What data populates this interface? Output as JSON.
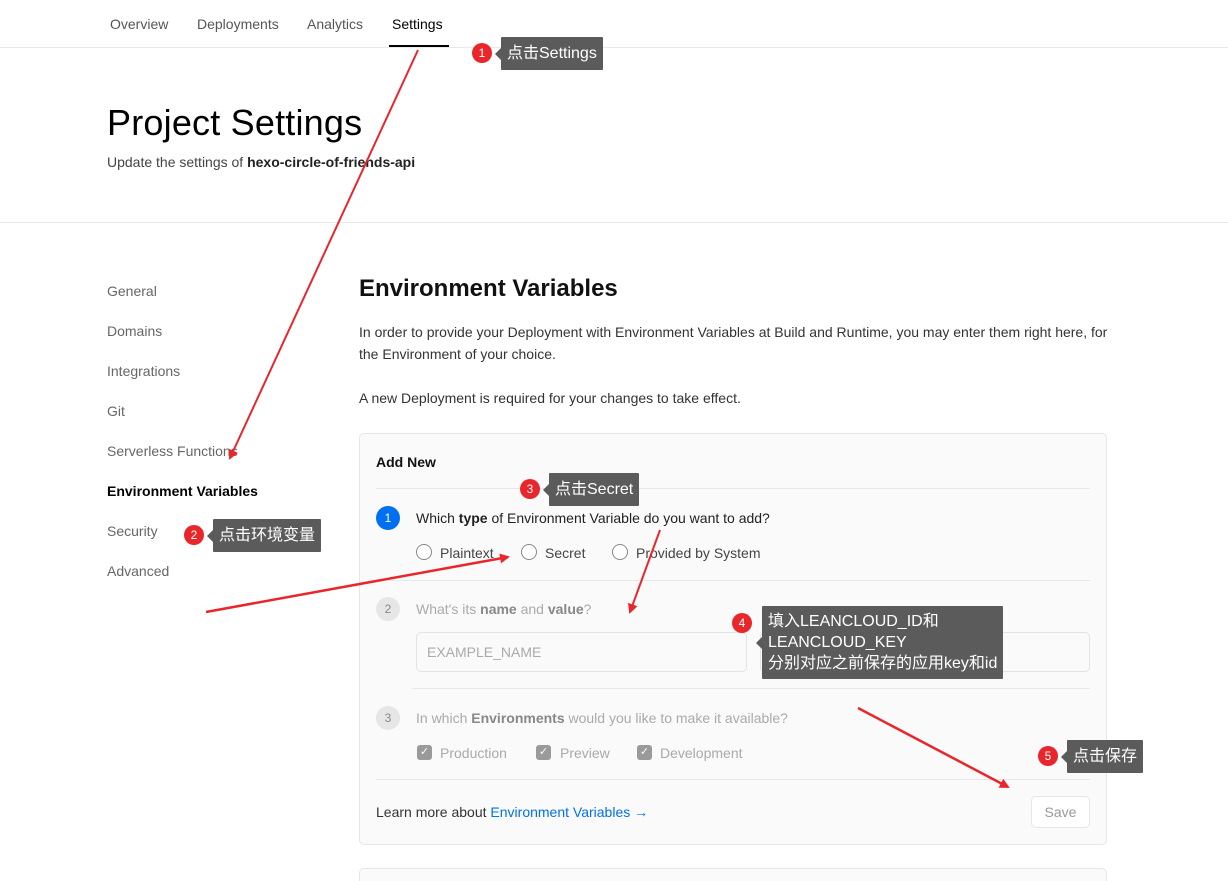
{
  "tabs": [
    "Overview",
    "Deployments",
    "Analytics",
    "Settings"
  ],
  "header": {
    "title": "Project Settings",
    "subtitle_prefix": "Update the settings of",
    "project_name": "hexo-circle-of-friends-api"
  },
  "sidebar": {
    "items": [
      "General",
      "Domains",
      "Integrations",
      "Git",
      "Serverless Functions",
      "Environment Variables",
      "Security",
      "Advanced"
    ],
    "active": "Environment Variables"
  },
  "main": {
    "title": "Environment Variables",
    "desc1": "In order to provide your Deployment with Environment Variables at Build and Runtime, you may enter them right here, for the Environment of your choice.",
    "desc2": "A new Deployment is required for your changes to take effect."
  },
  "card": {
    "title": "Add New",
    "step1": {
      "num": "1",
      "pre": "Which",
      "bold": "type",
      "post": "of Environment Variable do you want to add?"
    },
    "types": [
      "Plaintext",
      "Secret",
      "Provided by System"
    ],
    "step2": {
      "num": "2",
      "pre": "What's its",
      "bold1": "name",
      "mid": "and",
      "bold2": "value",
      "post": "?"
    },
    "name_placeholder": "EXAMPLE_NAME",
    "step3": {
      "num": "3",
      "pre": "In which",
      "bold": "Environments",
      "post": "would you like to make it available?"
    },
    "environments": [
      "Production",
      "Preview",
      "Development"
    ],
    "footer_prefix": "Learn more about",
    "footer_link": "Environment Variables →",
    "save": "Save"
  },
  "annotations": [
    {
      "num": "1",
      "text": "点击Settings"
    },
    {
      "num": "2",
      "text": "点击环境变量"
    },
    {
      "num": "3",
      "text": "点击Secret"
    },
    {
      "num": "4",
      "lines": [
        "填入LEANCLOUD_ID和",
        "LEANCLOUD_KEY",
        "分别对应之前保存的应用key和id"
      ]
    },
    {
      "num": "5",
      "text": "点击保存"
    }
  ],
  "colors": {
    "accent": "#0070f3",
    "annotation_badge": "#e8262b",
    "annotation_box": "#5b5b5b",
    "arrow": "#e8262b"
  }
}
